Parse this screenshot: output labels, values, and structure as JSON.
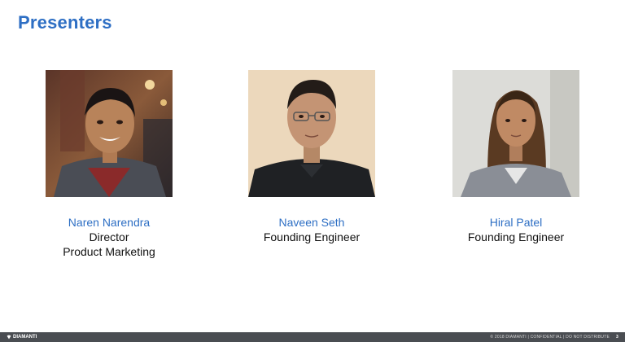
{
  "slide": {
    "title": "Presenters",
    "presenters": [
      {
        "name": "Naren Narendra",
        "role_line1": "Director",
        "role_line2": "Product Marketing"
      },
      {
        "name": "Naveen Seth",
        "role_line1": "Founding Engineer",
        "role_line2": ""
      },
      {
        "name": "Hiral Patel",
        "role_line1": "Founding Engineer",
        "role_line2": ""
      }
    ]
  },
  "footer": {
    "brand": "DIAMANTI",
    "copyright": "© 2018 DIAMANTI | CONFIDENTIAL | DO NOT DISTRIBUTE",
    "page_number": "3"
  },
  "colors": {
    "title_blue": "#2e6fc4",
    "footer_bg": "#4a4d52"
  },
  "icons": {
    "brand_mark": "diamond-logo-icon"
  }
}
